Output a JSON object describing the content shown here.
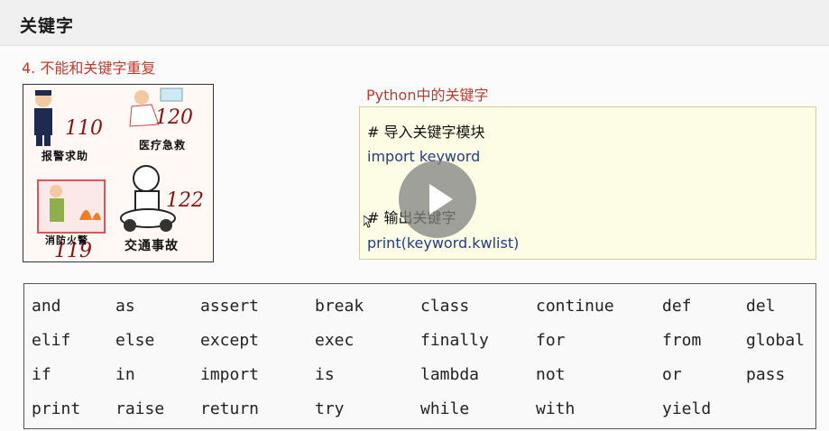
{
  "header": {
    "title": "关键字"
  },
  "subtitle": "4. 不能和关键字重复",
  "poster": {
    "items": [
      {
        "number": "110",
        "caption": "报警求助"
      },
      {
        "number": "120",
        "caption": "医疗急救"
      },
      {
        "number": "119",
        "caption": "消防火警"
      },
      {
        "number": "122",
        "caption": "交通事故"
      }
    ]
  },
  "code_section": {
    "label": "Python中的关键字",
    "lines": [
      {
        "kind": "comment",
        "text": "# 导入关键字模块"
      },
      {
        "kind": "code",
        "text": "import keyword"
      },
      {
        "kind": "comment",
        "text": "# 输出关键字"
      },
      {
        "kind": "code",
        "text": "print(keyword.kwlist)"
      }
    ]
  },
  "keywords": [
    [
      "and",
      "as",
      "assert",
      "break",
      "class",
      "continue",
      "def",
      "del"
    ],
    [
      "elif",
      "else",
      "except",
      "exec",
      "finally",
      "for",
      "from",
      "global"
    ],
    [
      "if",
      "in",
      "import",
      "is",
      "lambda",
      "not",
      "or",
      "pass"
    ],
    [
      "print",
      "raise",
      "return",
      "try",
      "while",
      "with",
      "yield",
      ""
    ]
  ],
  "icons": {
    "video": "play-icon",
    "pointer": "mouse-cursor-icon"
  },
  "colors": {
    "accent": "#c0392b",
    "code_text": "#1f3d8c",
    "code_bg": "#fdfde6"
  }
}
